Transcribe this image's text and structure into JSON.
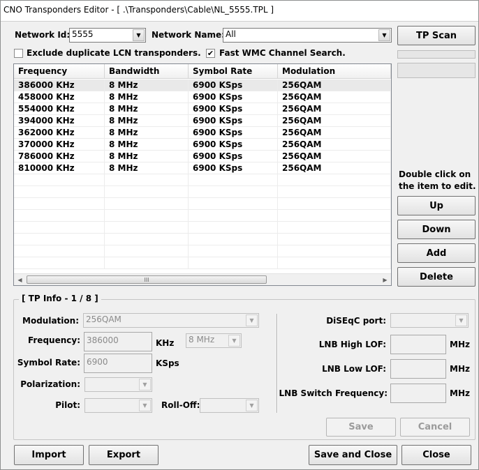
{
  "window": {
    "title": "CNO Transponders Editor - [ .\\Transponders\\Cable\\NL_5555.TPL ]"
  },
  "network": {
    "id_label": "Network Id:",
    "id_value": "5555",
    "name_label": "Network Name:",
    "name_value": "All"
  },
  "options": {
    "exclude_dup": {
      "label": "Exclude duplicate LCN transponders.",
      "checked": false
    },
    "fast_wmc": {
      "label": "Fast WMC Channel Search.",
      "checked": true,
      "mark": "✔"
    }
  },
  "table": {
    "columns": [
      "Frequency",
      "Bandwidth",
      "Symbol Rate",
      "Modulation"
    ],
    "rows": [
      [
        "386000 KHz",
        "8 MHz",
        "6900 KSps",
        "256QAM"
      ],
      [
        "458000 KHz",
        "8 MHz",
        "6900 KSps",
        "256QAM"
      ],
      [
        "554000 KHz",
        "8 MHz",
        "6900 KSps",
        "256QAM"
      ],
      [
        "394000 KHz",
        "8 MHz",
        "6900 KSps",
        "256QAM"
      ],
      [
        "362000 KHz",
        "8 MHz",
        "6900 KSps",
        "256QAM"
      ],
      [
        "370000 KHz",
        "8 MHz",
        "6900 KSps",
        "256QAM"
      ],
      [
        "786000 KHz",
        "8 MHz",
        "6900 KSps",
        "256QAM"
      ],
      [
        "810000 KHz",
        "8 MHz",
        "6900 KSps",
        "256QAM"
      ]
    ],
    "selected_row": 0,
    "scroll_thumb_glyph": "III"
  },
  "side": {
    "tp_scan": "TP Scan",
    "hint_line1": "Double click on",
    "hint_line2": "the item to edit.",
    "up": "Up",
    "down": "Down",
    "add": "Add",
    "delete": "Delete"
  },
  "tpinfo": {
    "title": "[ TP Info - 1 / 8 ]",
    "modulation_label": "Modulation:",
    "modulation_value": "256QAM",
    "frequency_label": "Frequency:",
    "frequency_value": "386000",
    "frequency_unit": "KHz",
    "bandwidth_value": "8 MHz",
    "symbol_rate_label": "Symbol Rate:",
    "symbol_rate_value": "6900",
    "symbol_rate_unit": "KSps",
    "polarization_label": "Polarization:",
    "pilot_label": "Pilot:",
    "rolloff_label": "Roll-Off:",
    "diseqc_label": "DiSEqC port:",
    "lnb_high_label": "LNB High LOF:",
    "lnb_low_label": "LNB Low LOF:",
    "lnb_switch_label": "LNB Switch Frequency:",
    "mhz_unit": "MHz",
    "save": "Save",
    "cancel": "Cancel"
  },
  "footer": {
    "import": "Import",
    "export": "Export",
    "save_close": "Save and Close",
    "close": "Close"
  },
  "icons": {
    "dropdown": "▼",
    "scroll_left": "◀",
    "scroll_right": "▶"
  }
}
